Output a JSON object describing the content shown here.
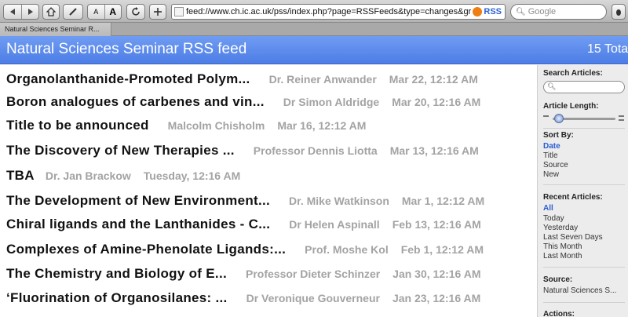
{
  "toolbar": {
    "url": "feed://www.ch.ic.ac.uk/pss/index.php?page=RSSFeeds&type=changes&group=",
    "rss_label": "RSS",
    "search_placeholder": "Google",
    "text_smaller": "A",
    "text_larger": "A"
  },
  "tab": {
    "label": "Natural Sciences Seminar R..."
  },
  "header": {
    "title": "Natural Sciences Seminar RSS feed",
    "total": "15 Tota"
  },
  "articles": [
    {
      "title": "Organolanthanide-Promoted Polym...",
      "author": "Dr. Reiner Anwander",
      "date": "Mar 22, 12:12 AM"
    },
    {
      "title": "Boron analogues of carbenes and vin...",
      "author": "Dr Simon Aldridge",
      "date": "Mar 20, 12:16 AM"
    },
    {
      "title": "Title to be announced",
      "author": "Malcolm Chisholm",
      "date": "Mar 16, 12:12 AM"
    },
    {
      "title": "The Discovery of New Therapies ...",
      "author": "Professor Dennis Liotta",
      "date": "Mar 13, 12:16 AM"
    },
    {
      "title": "TBA",
      "author": "Dr. Jan Brackow",
      "date": "Tuesday, 12:16 AM"
    },
    {
      "title": "The Development of New Environment...",
      "author": "Dr. Mike Watkinson",
      "date": "Mar 1, 12:12 AM"
    },
    {
      "title": "Chiral ligands and the Lanthanides - C...",
      "author": "Dr Helen Aspinall",
      "date": "Feb 13, 12:16 AM"
    },
    {
      "title": "Complexes of Amine-Phenolate Ligands:...",
      "author": "Prof. Moshe Kol",
      "date": "Feb 1, 12:12 AM"
    },
    {
      "title": "The Chemistry and Biology of E...",
      "author": "Professor Dieter Schinzer",
      "date": "Jan 30, 12:16 AM"
    },
    {
      "title": "‘Fluorination of Organosilanes: ...",
      "author": "Dr Veronique Gouverneur",
      "date": "Jan 23, 12:16 AM"
    }
  ],
  "sidebar": {
    "search_label": "Search Articles:",
    "length_label": "Article Length:",
    "length_level": 0.1,
    "sort_label": "Sort By:",
    "sort_options": [
      "Date",
      "Title",
      "Source",
      "New"
    ],
    "recent_label": "Recent Articles:",
    "recent_options": [
      "All",
      "Today",
      "Yesterday",
      "Last Seven Days",
      "This Month",
      "Last Month"
    ],
    "source_label": "Source:",
    "source_value": "Natural Sciences S...",
    "actions_label": "Actions:"
  }
}
